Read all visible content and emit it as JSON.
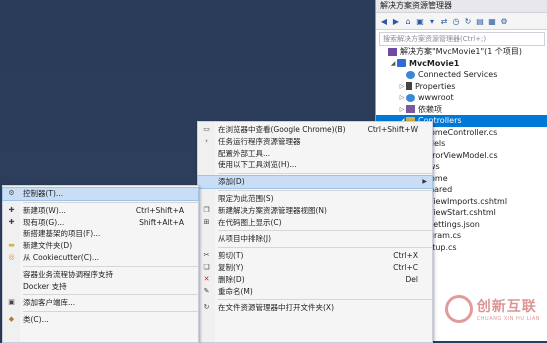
{
  "solution_explorer": {
    "title": "解决方案资源管理器",
    "search_placeholder": "搜索解决方案资源管理器(Ctrl+;)",
    "toolbar_icons": [
      "back-icon",
      "forward-icon",
      "home-icon",
      "solution-icon",
      "dropdown-icon",
      "sync-icon",
      "history-icon",
      "refresh-icon",
      "collapse-icon",
      "view-icon",
      "settings-icon"
    ],
    "tree": [
      {
        "label": "解决方案\"MvcMovie1\"(1 个项目)",
        "icon": "solution-icon",
        "arrow": "",
        "indent": 0
      },
      {
        "label": "MvcMovie1",
        "icon": "project-icon",
        "arrow": "◢",
        "indent": 1,
        "bold": true
      },
      {
        "label": "Connected Services",
        "icon": "connected-services-icon",
        "arrow": "",
        "indent": 2
      },
      {
        "label": "Properties",
        "icon": "wrench-icon",
        "arrow": "▷",
        "indent": 2
      },
      {
        "label": "wwwroot",
        "icon": "globe-icon",
        "arrow": "▷",
        "indent": 2
      },
      {
        "label": "依赖项",
        "icon": "dependencies-icon",
        "arrow": "▷",
        "indent": 2
      },
      {
        "label": "Controllers",
        "icon": "folder-icon",
        "arrow": "◢",
        "indent": 2,
        "selected": true
      },
      {
        "label": "HomeController.cs",
        "icon": "",
        "arrow": "",
        "indent": 4
      },
      {
        "label": "odels",
        "icon": "",
        "arrow": "",
        "indent": 4
      },
      {
        "label": "ErrorViewModel.cs",
        "icon": "",
        "arrow": "",
        "indent": 4
      },
      {
        "label": "ews",
        "icon": "",
        "arrow": "",
        "indent": 4
      },
      {
        "label": "Home",
        "icon": "",
        "arrow": "",
        "indent": 4
      },
      {
        "label": "Shared",
        "icon": "",
        "arrow": "",
        "indent": 4
      },
      {
        "label": "_ViewImports.cshtml",
        "icon": "",
        "arrow": "",
        "indent": 4
      },
      {
        "label": "_ViewStart.cshtml",
        "icon": "",
        "arrow": "",
        "indent": 4
      },
      {
        "label": "psettings.json",
        "icon": "",
        "arrow": "",
        "indent": 4
      },
      {
        "label": "ogram.cs",
        "icon": "",
        "arrow": "",
        "indent": 4
      },
      {
        "label": "artup.cs",
        "icon": "",
        "arrow": "",
        "indent": 4
      }
    ]
  },
  "context_menu": {
    "items": [
      {
        "label": "在浏览器中查看(Google Chrome)(B)",
        "shortcut": "Ctrl+Shift+W",
        "icon": "browser-icon"
      },
      {
        "label": "任务运行程序资源管理器",
        "shortcut": "",
        "icon": "chevron-right-icon"
      },
      {
        "label": "配置外部工具...",
        "shortcut": "",
        "icon": ""
      },
      {
        "label": "使用以下工具浏览(H)...",
        "shortcut": "",
        "icon": ""
      },
      {
        "sep": true
      },
      {
        "label": "添加(D)",
        "shortcut": "",
        "icon": "",
        "submenu": true,
        "highlighted": true
      },
      {
        "sep": true
      },
      {
        "label": "限定为此范围(S)",
        "shortcut": "",
        "icon": ""
      },
      {
        "label": "新建解决方案资源管理器视图(N)",
        "shortcut": "",
        "icon": "new-view-icon"
      },
      {
        "label": "在代码图上显示(C)",
        "shortcut": "",
        "icon": "code-map-icon"
      },
      {
        "sep": true
      },
      {
        "label": "从项目中排除(J)",
        "shortcut": "",
        "icon": ""
      },
      {
        "sep": true
      },
      {
        "label": "剪切(T)",
        "shortcut": "Ctrl+X",
        "icon": "scissors-icon"
      },
      {
        "label": "复制(Y)",
        "shortcut": "Ctrl+C",
        "icon": "copy-icon"
      },
      {
        "label": "删除(D)",
        "shortcut": "Del",
        "icon": "delete-icon"
      },
      {
        "label": "重命名(M)",
        "shortcut": "",
        "icon": "rename-icon"
      },
      {
        "sep": true
      },
      {
        "label": "在文件资源管理器中打开文件夹(X)",
        "shortcut": "",
        "icon": "folder-open-icon"
      }
    ]
  },
  "add_submenu": {
    "items": [
      {
        "label": "控制器(T)...",
        "shortcut": "",
        "icon": "controller-icon",
        "highlighted": true
      },
      {
        "sep": true
      },
      {
        "label": "新建项(W)...",
        "shortcut": "Ctrl+Shift+A",
        "icon": "new-item-icon"
      },
      {
        "label": "现有项(G)...",
        "shortcut": "Shift+Alt+A",
        "icon": "existing-item-icon"
      },
      {
        "label": "新搭建基架的项目(F)...",
        "shortcut": "",
        "icon": ""
      },
      {
        "label": "新建文件夹(D)",
        "shortcut": "",
        "icon": "new-folder-icon"
      },
      {
        "label": "从 Cookiecutter(C)...",
        "shortcut": "",
        "icon": "cookiecutter-icon"
      },
      {
        "sep": true
      },
      {
        "label": "容器业务流程协调程序支持",
        "shortcut": "",
        "icon": ""
      },
      {
        "label": "Docker 支持",
        "shortcut": "",
        "icon": ""
      },
      {
        "sep": true
      },
      {
        "label": "添加客户端库...",
        "shortcut": "",
        "icon": "client-library-icon"
      },
      {
        "sep": true
      },
      {
        "label": "类(C)...",
        "shortcut": "",
        "icon": "class-icon"
      }
    ]
  },
  "watermark": {
    "title": "创新互联",
    "subtitle": "CHUANG XIN HU LIAN"
  }
}
